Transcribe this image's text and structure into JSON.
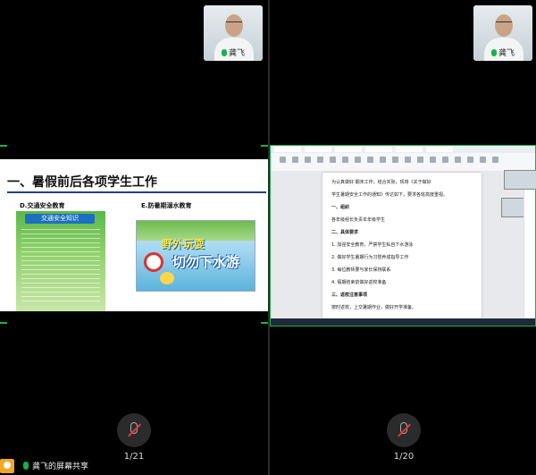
{
  "participant": {
    "name": "龚飞"
  },
  "left": {
    "slide": {
      "title": "一、暑假前后各项学生工作",
      "sub_d": "D.交通安全教育",
      "sub_e": "E.防暑期溺水教育",
      "poster_left_banner": "交通安全知识",
      "poster_right_title1": "野外玩耍",
      "poster_right_title2": "切勿下水游"
    },
    "page_counter": "1/21",
    "share_label": "龚飞的屏幕共享"
  },
  "right": {
    "doc_lines": [
      {
        "text": "为认真做好 期末工作，结合实际，现将《关于做好",
        "bold": false
      },
      {
        "text": "学生暑期安全工作的通知》传达如下，要求各班高度重视。",
        "bold": false
      },
      {
        "text": "一、组织",
        "bold": true
      },
      {
        "text": "各年级组长负责本年级学生",
        "bold": false
      },
      {
        "text": "二、具体要求",
        "bold": true
      },
      {
        "text": "1. 加强安全教育，严禁学生私自下水游泳",
        "bold": false
      },
      {
        "text": "2. 做好学生暑期行为习惯养成指导工作",
        "bold": false
      },
      {
        "text": "3. 每位教师要与家长保持联系",
        "bold": false
      },
      {
        "text": "4. 假期结束前做好返校准备",
        "bold": false
      },
      {
        "text": "三、返校注意事项",
        "bold": true
      },
      {
        "text": "按时返校，上交暑期作业，做好开学准备。",
        "bold": false
      }
    ],
    "page_counter": "1/20"
  }
}
